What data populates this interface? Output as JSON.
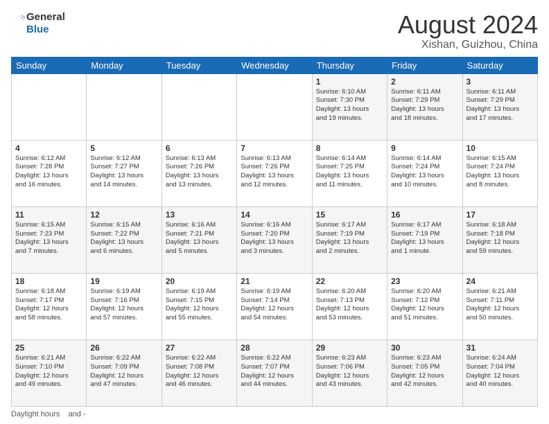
{
  "logo": {
    "text_general": "General",
    "text_blue": "Blue"
  },
  "title": "August 2024",
  "subtitle": "Xishan, Guizhou, China",
  "days_of_week": [
    "Sunday",
    "Monday",
    "Tuesday",
    "Wednesday",
    "Thursday",
    "Friday",
    "Saturday"
  ],
  "weeks": [
    [
      {
        "num": "",
        "info": ""
      },
      {
        "num": "",
        "info": ""
      },
      {
        "num": "",
        "info": ""
      },
      {
        "num": "",
        "info": ""
      },
      {
        "num": "1",
        "info": "Sunrise: 6:10 AM\nSunset: 7:30 PM\nDaylight: 13 hours\nand 19 minutes."
      },
      {
        "num": "2",
        "info": "Sunrise: 6:11 AM\nSunset: 7:29 PM\nDaylight: 13 hours\nand 18 minutes."
      },
      {
        "num": "3",
        "info": "Sunrise: 6:11 AM\nSunset: 7:29 PM\nDaylight: 13 hours\nand 17 minutes."
      }
    ],
    [
      {
        "num": "4",
        "info": "Sunrise: 6:12 AM\nSunset: 7:28 PM\nDaylight: 13 hours\nand 16 minutes."
      },
      {
        "num": "5",
        "info": "Sunrise: 6:12 AM\nSunset: 7:27 PM\nDaylight: 13 hours\nand 14 minutes."
      },
      {
        "num": "6",
        "info": "Sunrise: 6:13 AM\nSunset: 7:26 PM\nDaylight: 13 hours\nand 13 minutes."
      },
      {
        "num": "7",
        "info": "Sunrise: 6:13 AM\nSunset: 7:26 PM\nDaylight: 13 hours\nand 12 minutes."
      },
      {
        "num": "8",
        "info": "Sunrise: 6:14 AM\nSunset: 7:25 PM\nDaylight: 13 hours\nand 11 minutes."
      },
      {
        "num": "9",
        "info": "Sunrise: 6:14 AM\nSunset: 7:24 PM\nDaylight: 13 hours\nand 10 minutes."
      },
      {
        "num": "10",
        "info": "Sunrise: 6:15 AM\nSunset: 7:24 PM\nDaylight: 13 hours\nand 8 minutes."
      }
    ],
    [
      {
        "num": "11",
        "info": "Sunrise: 6:15 AM\nSunset: 7:23 PM\nDaylight: 13 hours\nand 7 minutes."
      },
      {
        "num": "12",
        "info": "Sunrise: 6:15 AM\nSunset: 7:22 PM\nDaylight: 13 hours\nand 6 minutes."
      },
      {
        "num": "13",
        "info": "Sunrise: 6:16 AM\nSunset: 7:21 PM\nDaylight: 13 hours\nand 5 minutes."
      },
      {
        "num": "14",
        "info": "Sunrise: 6:16 AM\nSunset: 7:20 PM\nDaylight: 13 hours\nand 3 minutes."
      },
      {
        "num": "15",
        "info": "Sunrise: 6:17 AM\nSunset: 7:19 PM\nDaylight: 13 hours\nand 2 minutes."
      },
      {
        "num": "16",
        "info": "Sunrise: 6:17 AM\nSunset: 7:19 PM\nDaylight: 13 hours\nand 1 minute."
      },
      {
        "num": "17",
        "info": "Sunrise: 6:18 AM\nSunset: 7:18 PM\nDaylight: 12 hours\nand 59 minutes."
      }
    ],
    [
      {
        "num": "18",
        "info": "Sunrise: 6:18 AM\nSunset: 7:17 PM\nDaylight: 12 hours\nand 58 minutes."
      },
      {
        "num": "19",
        "info": "Sunrise: 6:19 AM\nSunset: 7:16 PM\nDaylight: 12 hours\nand 57 minutes."
      },
      {
        "num": "20",
        "info": "Sunrise: 6:19 AM\nSunset: 7:15 PM\nDaylight: 12 hours\nand 55 minutes."
      },
      {
        "num": "21",
        "info": "Sunrise: 6:19 AM\nSunset: 7:14 PM\nDaylight: 12 hours\nand 54 minutes."
      },
      {
        "num": "22",
        "info": "Sunrise: 6:20 AM\nSunset: 7:13 PM\nDaylight: 12 hours\nand 53 minutes."
      },
      {
        "num": "23",
        "info": "Sunrise: 6:20 AM\nSunset: 7:12 PM\nDaylight: 12 hours\nand 51 minutes."
      },
      {
        "num": "24",
        "info": "Sunrise: 6:21 AM\nSunset: 7:11 PM\nDaylight: 12 hours\nand 50 minutes."
      }
    ],
    [
      {
        "num": "25",
        "info": "Sunrise: 6:21 AM\nSunset: 7:10 PM\nDaylight: 12 hours\nand 49 minutes."
      },
      {
        "num": "26",
        "info": "Sunrise: 6:22 AM\nSunset: 7:09 PM\nDaylight: 12 hours\nand 47 minutes."
      },
      {
        "num": "27",
        "info": "Sunrise: 6:22 AM\nSunset: 7:08 PM\nDaylight: 12 hours\nand 46 minutes."
      },
      {
        "num": "28",
        "info": "Sunrise: 6:22 AM\nSunset: 7:07 PM\nDaylight: 12 hours\nand 44 minutes."
      },
      {
        "num": "29",
        "info": "Sunrise: 6:23 AM\nSunset: 7:06 PM\nDaylight: 12 hours\nand 43 minutes."
      },
      {
        "num": "30",
        "info": "Sunrise: 6:23 AM\nSunset: 7:05 PM\nDaylight: 12 hours\nand 42 minutes."
      },
      {
        "num": "31",
        "info": "Sunrise: 6:24 AM\nSunset: 7:04 PM\nDaylight: 12 hours\nand 40 minutes."
      }
    ]
  ],
  "footer": {
    "daylight_label": "Daylight hours",
    "and_dash": "and -"
  }
}
